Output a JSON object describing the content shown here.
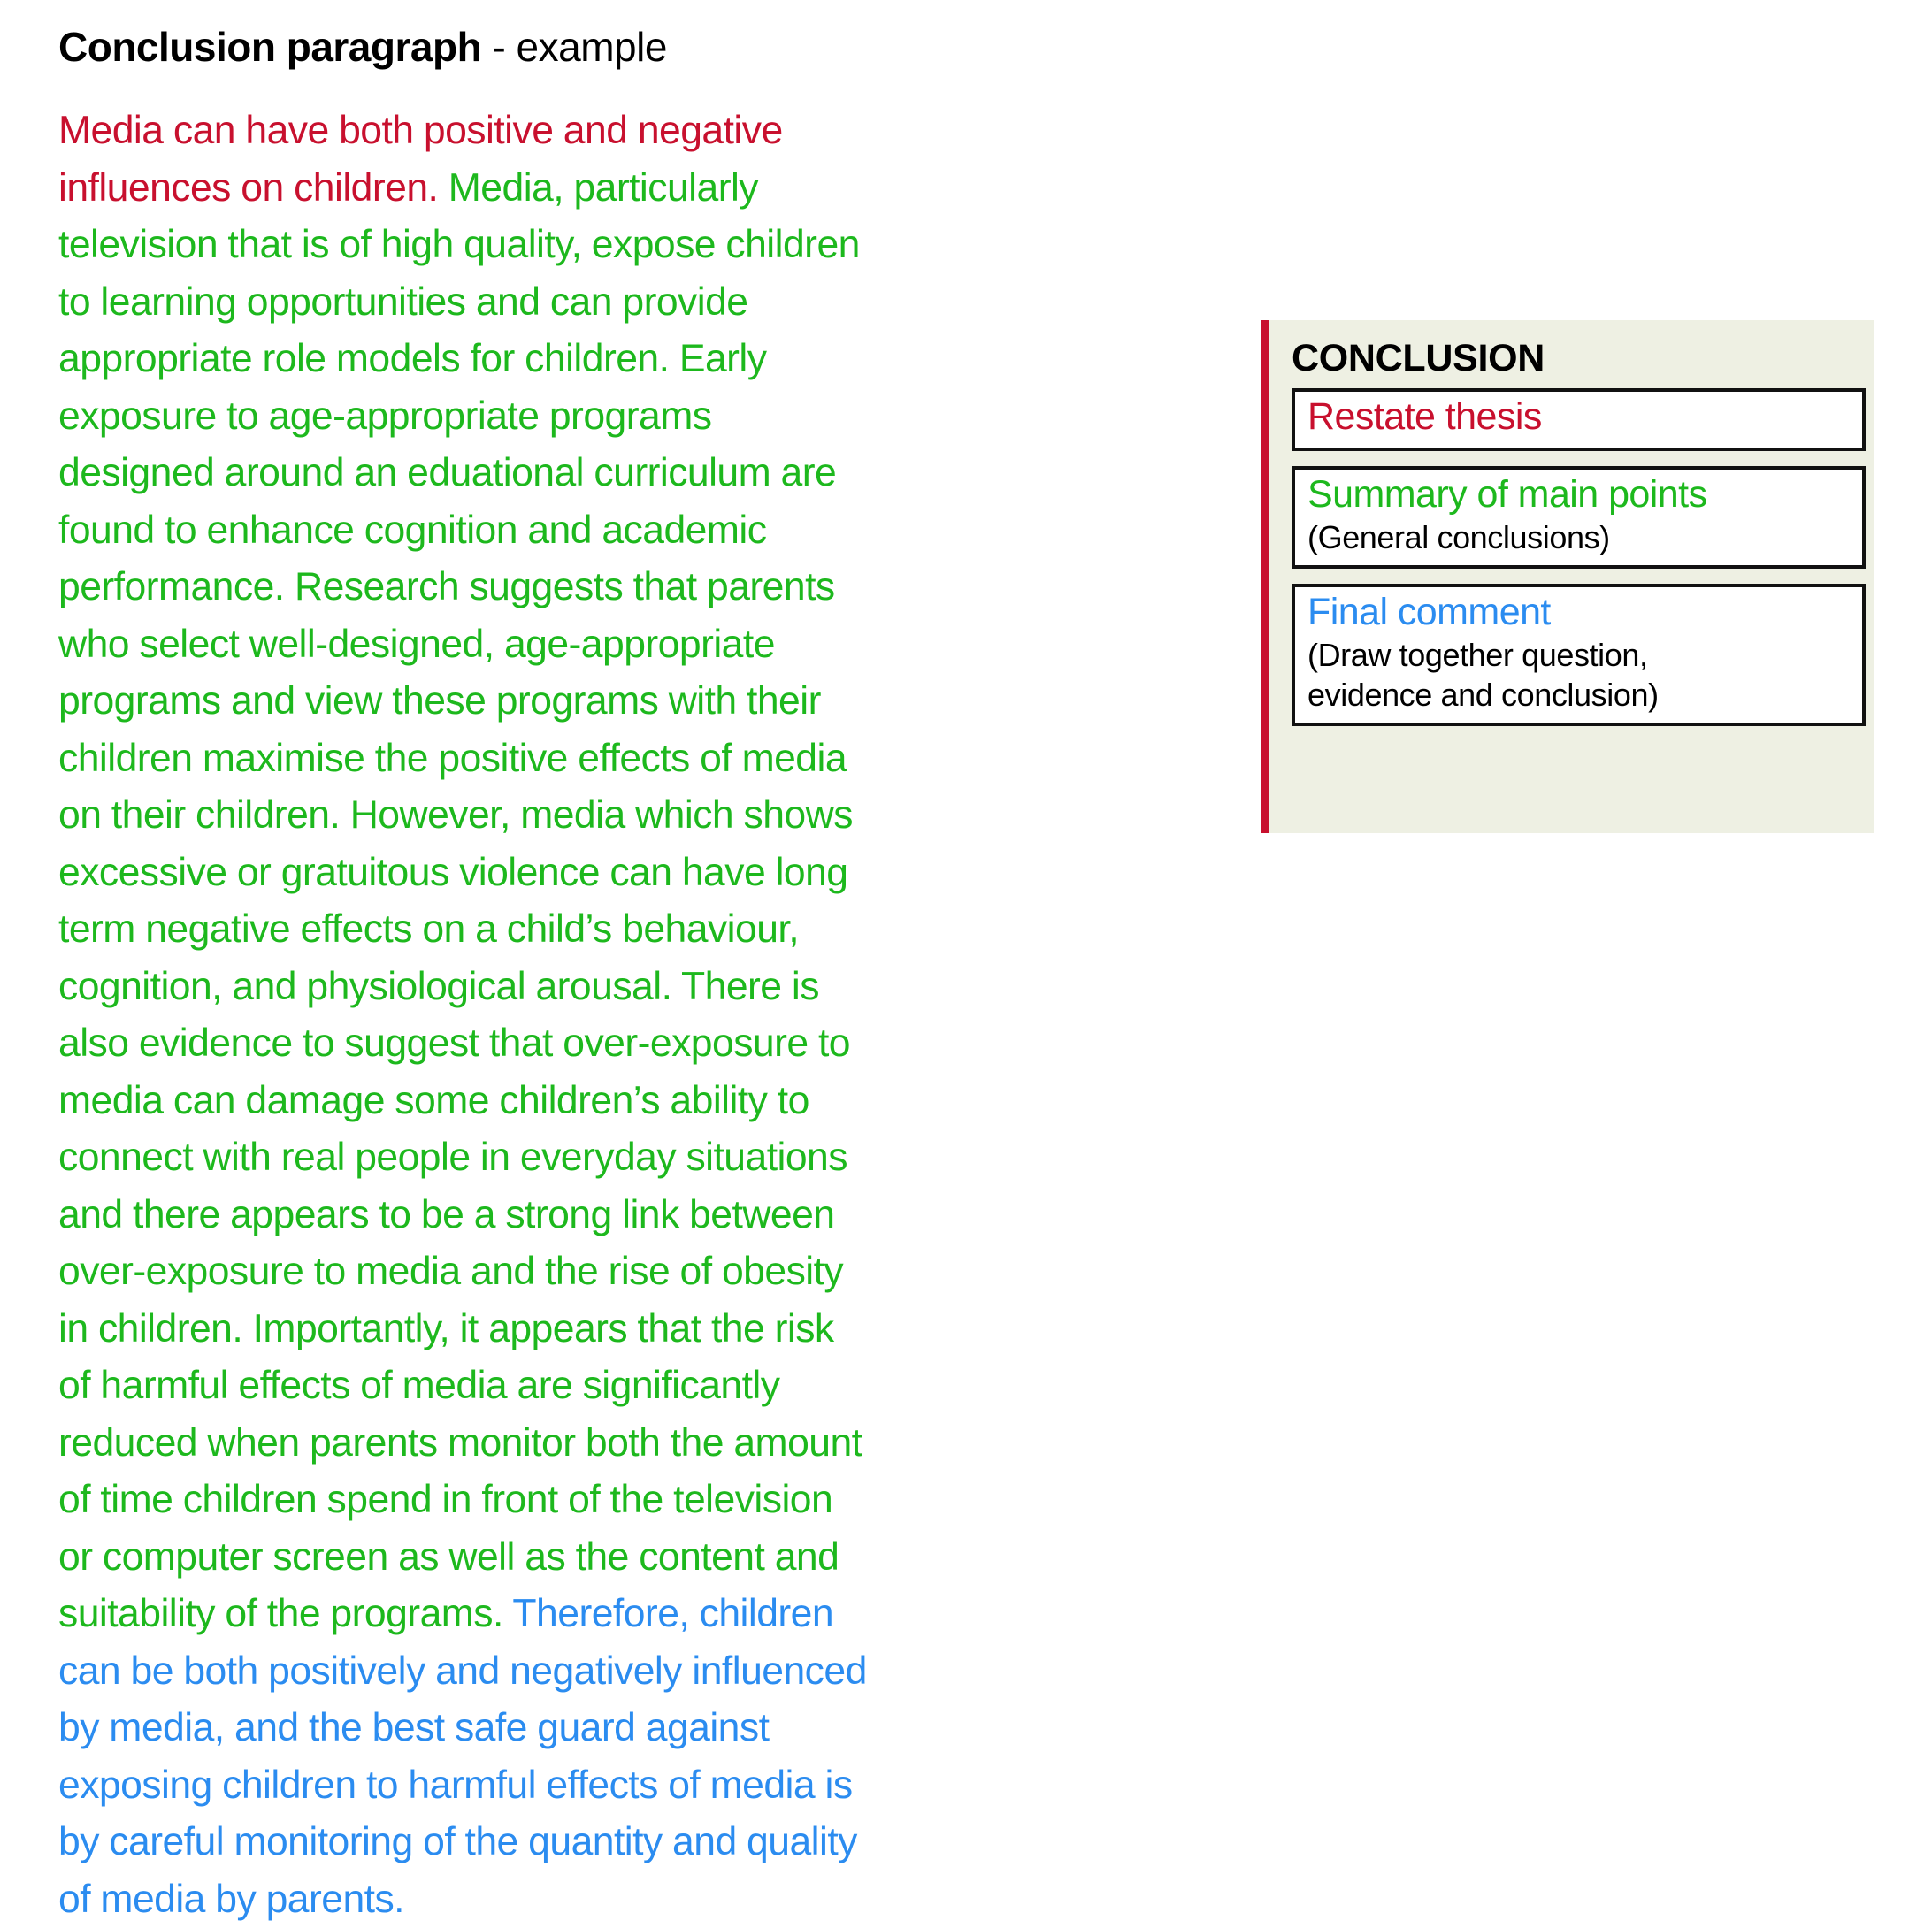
{
  "title": {
    "strong": "Conclusion paragraph",
    "rest": " - example"
  },
  "colors": {
    "red": "#C8102E",
    "green": "#1DB81D",
    "blue": "#2B8CF0",
    "panel_background": "#EEF0E3",
    "panel_accent": "#C8102E",
    "box_border": "#111111",
    "box_background": "#FFFFFF",
    "page_background": "#FFFFFF"
  },
  "paragraph": {
    "segments": [
      {
        "color_role": "red",
        "text": "Media can have both positive and negative influences on children."
      },
      {
        "color_role": "green",
        "text": "  Media, particularly television that is of high quality, expose children to learning opportunities and can provide appropriate role models for children.  Early exposure to age-appropriate programs designed around an eduational curriculum are found to enhance cognition and academic performance.  Research suggests that parents who select well-designed, age-appropriate programs and view these programs with their children maximise the positive effects of media on their children.  However, media which shows excessive or gratuitous violence can have long term negative effects on a child’s behaviour, cognition, and physiological arousal.  There is also evidence to suggest that over-exposure to media can damage some children’s ability to connect with real people in everyday situations and there appears to be a strong link between over-exposure to media and the rise of obesity in children.  Importantly, it appears that the risk of harmful effects of media are significantly reduced when parents monitor both the amount of time children spend in front of the television or computer screen as well as the content and suitability of the programs."
      },
      {
        "color_role": "blue",
        "text": "  Therefore, children can be both positively and negatively influenced by media, and the best safe guard against exposing children to harmful effects of media is by careful monitoring of the quantity and quality of media by parents."
      }
    ]
  },
  "side_panel": {
    "heading": "CONCLUSION",
    "boxes": [
      {
        "title": "Restate thesis",
        "title_color_role": "red",
        "subtitle": ""
      },
      {
        "title": "Summary of main points",
        "title_color_role": "green",
        "subtitle": "(General conclusions)"
      },
      {
        "title": "Final comment",
        "title_color_role": "blue",
        "subtitle": "(Draw together question,\nevidence and conclusion)"
      }
    ]
  }
}
